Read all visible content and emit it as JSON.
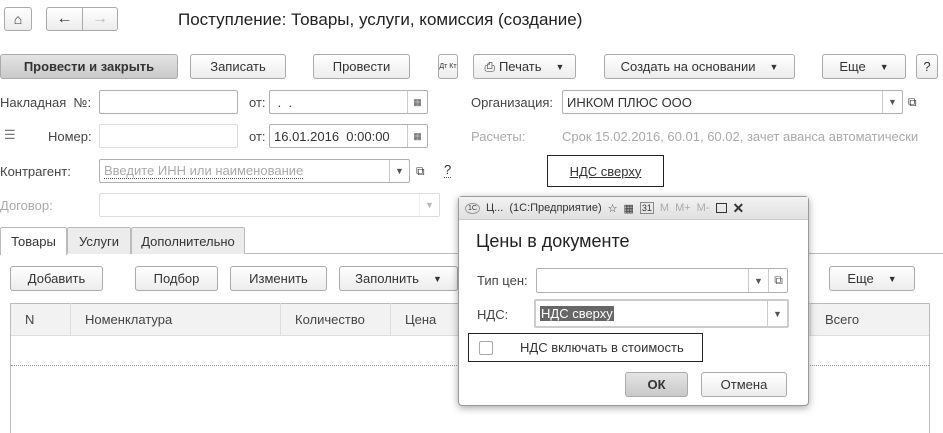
{
  "nav": {
    "home_icon": "home-icon",
    "back_icon": "arrow-left-icon",
    "forward_icon": "arrow-right-icon"
  },
  "title": "Поступление: Товары, услуги, комиссия (создание)",
  "toolbar": {
    "post_close": "Провести и закрыть",
    "save": "Записать",
    "post": "Провести",
    "dtkt": "Дт Кт",
    "print": "Печать",
    "create_based": "Создать на основании",
    "more": "Еще",
    "help": "?"
  },
  "form": {
    "invoice_label": "Накладная  №:",
    "invoice_value": "",
    "from_label": "от:",
    "invoice_date": " .  .",
    "number_label": "Номер:",
    "number_value": "",
    "date_value": "16.01.2016  0:00:00",
    "org_label": "Организация:",
    "org_value": "ИНКОМ ПЛЮС ООО",
    "settlements_label": "Расчеты:",
    "settlements_value": "Срок 15.02.2016, 60.01, 60.02, зачет аванса автоматически",
    "counterparty_label": "Контрагент:",
    "counterparty_placeholder": "Введите ИНН или наименование",
    "question": "?",
    "contract_label": "Договор:",
    "vat_link": "НДС сверху"
  },
  "tabs": [
    "Товары",
    "Услуги",
    "Дополнительно"
  ],
  "table_toolbar": {
    "add": "Добавить",
    "select": "Подбор",
    "edit": "Изменить",
    "fill": "Заполнить",
    "more": "Еще"
  },
  "table": {
    "columns": [
      "N",
      "Номенклатура",
      "Количество",
      "Цена",
      "Всего"
    ]
  },
  "dialog": {
    "title": "Ц...  (1С:Предприятие)",
    "m": "M",
    "mplus": "M+",
    "mminus": "M-",
    "heading": "Цены в документе",
    "price_type_label": "Тип цен:",
    "price_type_value": "",
    "vat_label": "НДС:",
    "vat_value": "НДС сверху",
    "include_vat": "НДС включать в стоимость",
    "include_vat_checked": false,
    "ok": "ОК",
    "cancel": "Отмена"
  }
}
